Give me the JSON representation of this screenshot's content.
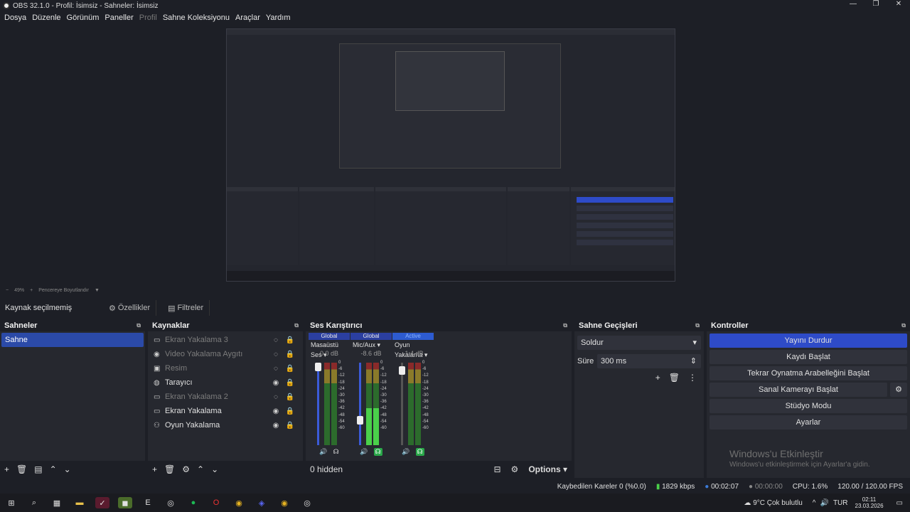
{
  "window": {
    "title": "OBS 32.1.0 - Profil: İsimsiz - Sahneler: İsimsiz"
  },
  "menu": [
    "Dosya",
    "Düzenle",
    "Görünüm",
    "Paneller",
    "Profil",
    "Sahne Koleksiyonu",
    "Araçlar",
    "Yardım"
  ],
  "zoom": {
    "value": "49%",
    "mode": "Pencereye Boyutlandır"
  },
  "source_bar": {
    "label": "Kaynak seçilmemiş",
    "properties": "Özellikler",
    "filters": "Filtreler"
  },
  "scenes": {
    "title": "Sahneler",
    "items": [
      "Sahne"
    ]
  },
  "sources": {
    "title": "Kaynaklar",
    "items": [
      {
        "name": "Ekran Yakalama 3",
        "hidden": true
      },
      {
        "name": "Video Yakalama Aygıtı",
        "hidden": true
      },
      {
        "name": "Resim",
        "hidden": true
      },
      {
        "name": "Tarayıcı",
        "hidden": false
      },
      {
        "name": "Ekran Yakalama 2",
        "hidden": true
      },
      {
        "name": "Ekran Yakalama",
        "hidden": false
      },
      {
        "name": "Oyun Yakalama",
        "hidden": false
      }
    ]
  },
  "mixer": {
    "title": "Ses Karıştırıcı",
    "hidden_label": "0 hidden",
    "options_label": "Options",
    "channels": [
      {
        "tag": "Global",
        "device": "Masaüstü Ses",
        "db": "0.0 dB",
        "level": 0.0,
        "meter": 0.0
      },
      {
        "tag": "Global",
        "device": "Mic/Aux",
        "db": "-8.6 dB",
        "level": 0.72,
        "meter": 0.45
      },
      {
        "tag": "Active",
        "device": "Oyun Yakalama",
        "db": "-1.4 dB",
        "level": 0.05,
        "meter": 0.0
      }
    ],
    "scale": [
      "0",
      "-6",
      "-12",
      "-18",
      "-24",
      "-30",
      "-36",
      "-42",
      "-48",
      "-54",
      "-60"
    ]
  },
  "transitions": {
    "title": "Sahne Geçişleri",
    "selected": "Soldur",
    "duration_label": "Süre",
    "duration": "300 ms"
  },
  "controls": {
    "title": "Kontroller",
    "buttons": [
      "Yayını Durdur",
      "Kaydı Başlat",
      "Tekrar Oynatma Arabelleğini Başlat",
      "Sanal Kamerayı Başlat",
      "Stüdyo Modu",
      "Ayarlar"
    ]
  },
  "watermark": {
    "title": "Windows'u Etkinleştir",
    "subtitle": "Windows'u etkinleştirmek için Ayarlar'a gidin."
  },
  "status": {
    "dropped": "Kaybedilen Kareler 0 (%0.0)",
    "bitrate": "1829 kbps",
    "stream_time": "00:02:07",
    "rec_time": "00:00:00",
    "cpu": "CPU: 1.6%",
    "fps": "120.00 / 120.00 FPS"
  },
  "taskbar": {
    "weather": "9°C  Çok bulutlu",
    "lang": "TUR",
    "time": "02:11",
    "date": "23.03.2026"
  }
}
